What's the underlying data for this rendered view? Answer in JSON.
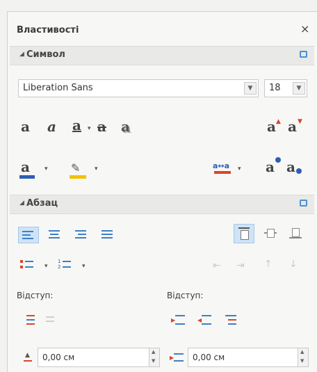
{
  "panel": {
    "title": "Властивості",
    "close_symbol": "×"
  },
  "character": {
    "header": "Символ",
    "font_name": "Liberation Sans",
    "font_size": "18"
  },
  "paragraph": {
    "header": "Абзац",
    "indent_label_left": "Відступ:",
    "indent_label_right": "Відступ:",
    "indent_left_value": "0,00 см",
    "indent_right_value": "0,00 см"
  },
  "icons": {
    "bold": "a",
    "italic": "a",
    "underline": "a",
    "strike": "a",
    "shadow": "a",
    "grow": "a",
    "shrink": "a",
    "superscript": "a",
    "subscript": "a"
  },
  "colors": {
    "accent": "#4a8fd6",
    "font_color": "#2f5fb3",
    "highlight": "#f2c200",
    "red": "#d9462b"
  }
}
